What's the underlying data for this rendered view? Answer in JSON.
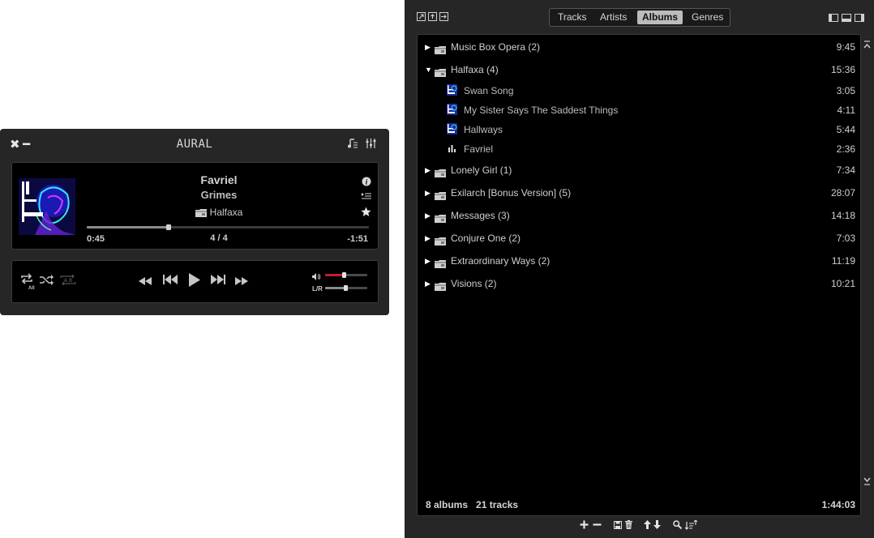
{
  "player": {
    "app_title": "AURAL",
    "close_icon": "✖",
    "minimize_icon": "━",
    "track": {
      "title": "Favriel",
      "artist": "Grimes",
      "album": "Halfaxa",
      "elapsed": "0:45",
      "position": "4 / 4",
      "remaining": "-1:51",
      "progress": 0.29
    },
    "controls": {
      "repeat_mode": "All",
      "volume": 0.45,
      "balance_label": "L/R",
      "balance": 0.48
    }
  },
  "library": {
    "tabs": [
      {
        "label": "Tracks"
      },
      {
        "label": "Artists"
      },
      {
        "label": "Albums"
      },
      {
        "label": "Genres"
      }
    ],
    "active_tab": "Albums",
    "albums": [
      {
        "label": "Music Box Opera (2)",
        "duration": "9:45"
      },
      {
        "label": "Halfaxa (4)",
        "duration": "15:36"
      },
      {
        "label": "Lonely Girl (1)",
        "duration": "7:34"
      },
      {
        "label": "Exilarch [Bonus Version] (5)",
        "duration": "28:07"
      },
      {
        "label": "Messages  (3)",
        "duration": "14:18"
      },
      {
        "label": "Conjure One (2)",
        "duration": "7:03"
      },
      {
        "label": "Extraordinary Ways (2)",
        "duration": "11:19"
      },
      {
        "label": "Visions (2)",
        "duration": "10:21"
      }
    ],
    "expanded_tracks": [
      {
        "label": "Swan Song",
        "duration": "3:05"
      },
      {
        "label": "My Sister Says The Saddest Things",
        "duration": "4:11"
      },
      {
        "label": "Hallways",
        "duration": "5:44"
      },
      {
        "label": "Favriel",
        "duration": "2:36",
        "playing": true
      }
    ],
    "summary": {
      "albums": "8 albums",
      "tracks": "21 tracks",
      "total_duration": "1:44:03"
    }
  },
  "colors": {
    "window_bg": "#262626",
    "panel_bg": "#000000",
    "volume_fill": "#c0202a",
    "active_tab_bg": "#bcbcbc"
  }
}
